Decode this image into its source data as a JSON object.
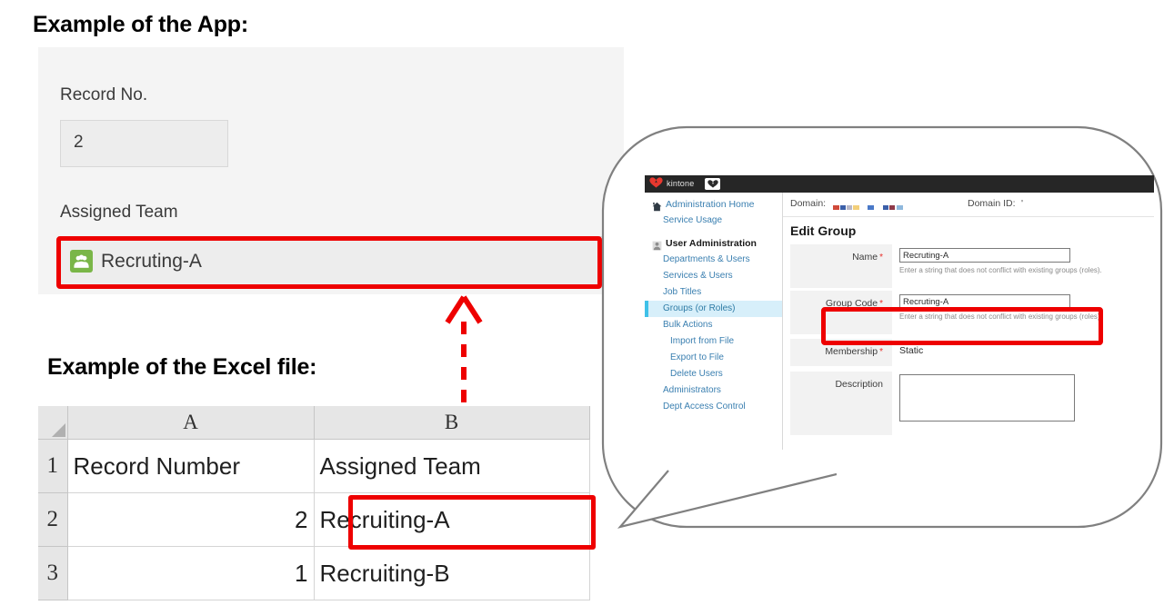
{
  "headings": {
    "app": "Example of the App:",
    "excel": "Example of the Excel file:"
  },
  "app_panel": {
    "record_no_label": "Record No.",
    "record_no_value": "2",
    "assigned_team_label": "Assigned Team",
    "assigned_team_value": "Recruting-A",
    "group_icon_name": "group-icon",
    "highlight_color": "#ee0000",
    "icon_color": "#7ab648"
  },
  "arrow": {
    "name": "red-dashed-up-arrow",
    "color": "#ee0000",
    "style": "dashed",
    "direction": "up"
  },
  "excel": {
    "column_headers": [
      "A",
      "B"
    ],
    "row_headers": [
      "1",
      "2",
      "3"
    ],
    "rows": [
      {
        "row": "1",
        "a": "Record Number",
        "b": "Assigned Team",
        "a_align": "left",
        "b_align": "left"
      },
      {
        "row": "2",
        "a": "2",
        "b": "Recruiting-A",
        "a_align": "right",
        "b_align": "left"
      },
      {
        "row": "3",
        "a": "1",
        "b": "Recruiting-B",
        "a_align": "right",
        "b_align": "left"
      }
    ],
    "highlighted_cell": "B2",
    "highlight_color": "#ee0000"
  },
  "kintone": {
    "header": {
      "logo_text": "kintone",
      "logo_color": "#e8382f",
      "bar_color": "#262626",
      "app_button_name": "kintone-apps-button"
    },
    "sidebar": {
      "items": [
        {
          "label": "Administration Home",
          "icon": "home-icon",
          "type": "link-with-icon",
          "active": false
        },
        {
          "label": "Service Usage",
          "icon": "",
          "type": "link",
          "active": false
        },
        {
          "label": "User Administration",
          "icon": "user-icon",
          "type": "group-head",
          "active": false
        },
        {
          "label": "Departments & Users",
          "icon": "",
          "type": "link",
          "active": false
        },
        {
          "label": "Services & Users",
          "icon": "",
          "type": "link",
          "active": false
        },
        {
          "label": "Job Titles",
          "icon": "",
          "type": "link",
          "active": false
        },
        {
          "label": "Groups (or Roles)",
          "icon": "",
          "type": "link",
          "active": true
        },
        {
          "label": "Bulk Actions",
          "icon": "",
          "type": "link",
          "active": false
        },
        {
          "label": "Import from File",
          "icon": "",
          "type": "sub",
          "active": false
        },
        {
          "label": "Export to File",
          "icon": "",
          "type": "sub",
          "active": false
        },
        {
          "label": "Delete Users",
          "icon": "",
          "type": "sub",
          "active": false
        },
        {
          "label": "Administrators",
          "icon": "",
          "type": "link",
          "active": false
        },
        {
          "label": "Dept Access Control",
          "icon": "",
          "type": "link",
          "active": false
        }
      ],
      "active_bg": "#d7effa",
      "active_border": "#3fc1e8",
      "link_color": "#3a7fb0"
    },
    "domain_bar": {
      "domain_label": "Domain:",
      "domain_value_masked": true,
      "domain_id_label": "Domain ID:",
      "domain_id_value": "'"
    },
    "form": {
      "title": "Edit Group",
      "fields": [
        {
          "label": "Name",
          "required": true,
          "type": "text",
          "value": "Recruting-A",
          "help": "Enter a string that does not conflict with existing groups (roles).",
          "highlighted": false
        },
        {
          "label": "Group Code",
          "required": true,
          "type": "text",
          "value": "Recruting-A",
          "help": "Enter a string that does not conflict with existing groups (roles).",
          "highlighted": true
        },
        {
          "label": "Membership",
          "required": true,
          "type": "static",
          "value": "Static",
          "help": "",
          "highlighted": false
        },
        {
          "label": "Description",
          "required": false,
          "type": "textarea",
          "value": "",
          "help": "",
          "highlighted": false
        }
      ],
      "required_marker": "*",
      "highlight_color": "#ee0000"
    }
  },
  "callout": {
    "name": "speech-bubble",
    "border_color": "#808080",
    "fill": "#ffffff",
    "points_to": "excel-cell-B2"
  }
}
